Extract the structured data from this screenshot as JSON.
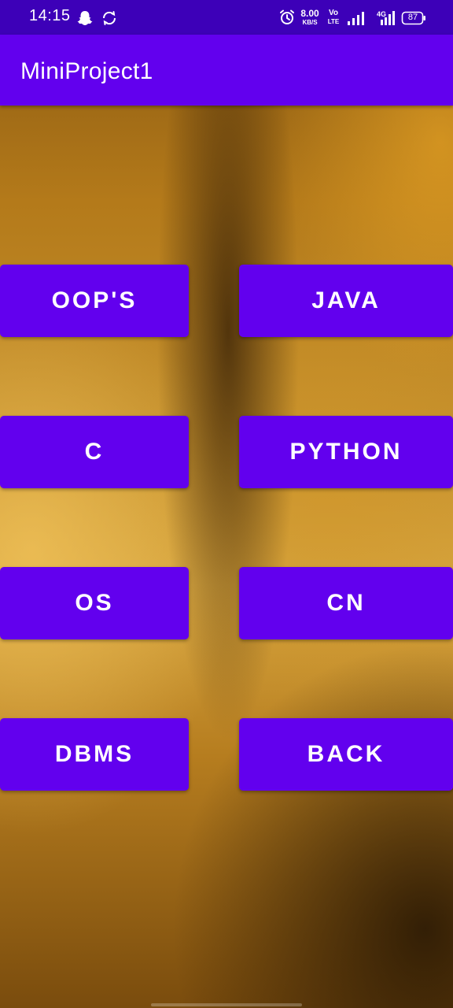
{
  "status_bar": {
    "time": "14:15",
    "network_speed_value": "8.00",
    "network_speed_unit": "KB/S",
    "volte_top": "Vo",
    "volte_bottom": "LTE",
    "network_type": "4G",
    "battery": "87",
    "icons": [
      "snapchat-icon",
      "sync-icon",
      "alarm-icon",
      "signal-icon",
      "signal-4g-icon",
      "battery-icon"
    ]
  },
  "app_bar": {
    "title": "MiniProject1"
  },
  "buttons": {
    "oops": "OOP'S",
    "java": "JAVA",
    "c": "C",
    "python": "PYTHON",
    "os": "OS",
    "cn": "CN",
    "dbms": "DBMS",
    "back": "BACK"
  },
  "colors": {
    "status_bar": "#3d00b8",
    "primary": "#6200ee",
    "text_on_primary": "#ffffff"
  }
}
